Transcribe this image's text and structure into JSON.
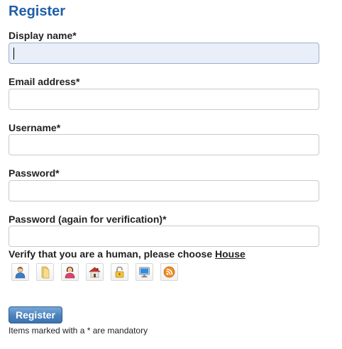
{
  "form": {
    "title": "Register",
    "fields": [
      {
        "label": "Display name",
        "required_mark": "*",
        "value": ""
      },
      {
        "label": "Email address",
        "required_mark": "*",
        "value": ""
      },
      {
        "label": "Username",
        "required_mark": "*",
        "value": ""
      },
      {
        "label": "Password",
        "required_mark": "*",
        "value": ""
      },
      {
        "label": "Password (again for verification)",
        "required_mark": "*",
        "value": ""
      }
    ],
    "focused_field": "Display name"
  },
  "captcha": {
    "prompt": "Verify that you are a human, please choose",
    "target_word": "House",
    "icons": [
      {
        "name": "user-icon"
      },
      {
        "name": "folder-icon"
      },
      {
        "name": "user-female-icon"
      },
      {
        "name": "house-icon"
      },
      {
        "name": "lock-icon"
      },
      {
        "name": "monitor-icon"
      },
      {
        "name": "rss-feed-icon"
      }
    ]
  },
  "actions": {
    "register_label": "Register"
  },
  "footer": {
    "note": "Items marked with a * are mandatory"
  },
  "colors": {
    "title": "#1f5fa8",
    "focused_field_bg": "#e9eef8",
    "button_blue": "#4a82bd"
  }
}
